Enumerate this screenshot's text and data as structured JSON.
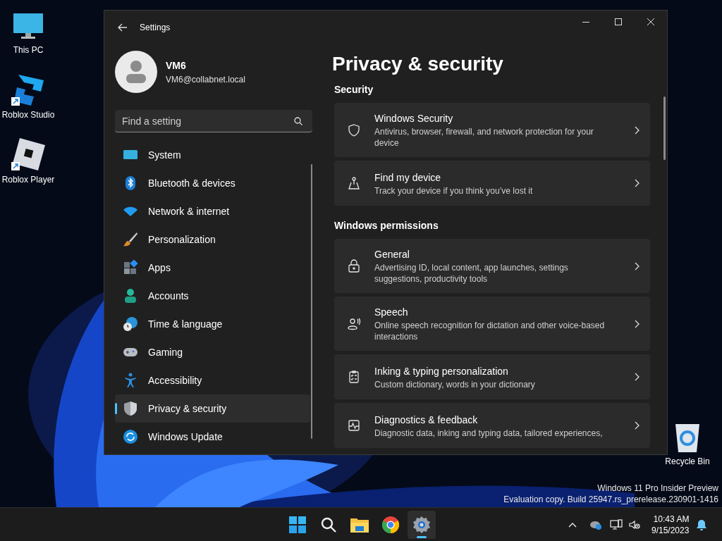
{
  "desktop_icons": [
    {
      "label": "This PC",
      "kind": "monitor",
      "shortcut": false
    },
    {
      "label": "Roblox Studio",
      "kind": "studio",
      "shortcut": true
    },
    {
      "label": "Roblox Player",
      "kind": "player",
      "shortcut": true
    },
    {
      "label": "Recycle Bin",
      "kind": "bin",
      "shortcut": false
    }
  ],
  "window": {
    "title": "Settings",
    "user": {
      "name": "VM6",
      "email": "VM6@collabnet.local"
    },
    "search": {
      "placeholder": "Find a setting"
    },
    "nav": [
      {
        "label": "System",
        "kind": "system",
        "selected": false
      },
      {
        "label": "Bluetooth & devices",
        "kind": "bluetooth",
        "selected": false
      },
      {
        "label": "Network & internet",
        "kind": "wifi",
        "selected": false
      },
      {
        "label": "Personalization",
        "kind": "brush",
        "selected": false
      },
      {
        "label": "Apps",
        "kind": "apps",
        "selected": false
      },
      {
        "label": "Accounts",
        "kind": "person",
        "selected": false
      },
      {
        "label": "Time & language",
        "kind": "globe",
        "selected": false
      },
      {
        "label": "Gaming",
        "kind": "gamepad",
        "selected": false
      },
      {
        "label": "Accessibility",
        "kind": "accessibility",
        "selected": false
      },
      {
        "label": "Privacy & security",
        "kind": "shield",
        "selected": true
      },
      {
        "label": "Windows Update",
        "kind": "update",
        "selected": false
      }
    ],
    "page_title": "Privacy & security",
    "sections": [
      {
        "heading": "Security",
        "items": [
          {
            "title": "Windows Security",
            "description": "Antivirus, browser, firewall, and network protection for your device",
            "kind": "shield"
          },
          {
            "title": "Find my device",
            "description": "Track your device if you think you’ve lost it",
            "kind": "locate"
          }
        ]
      },
      {
        "heading": "Windows permissions",
        "items": [
          {
            "title": "General",
            "description": "Advertising ID, local content, app launches, settings suggestions, productivity tools",
            "kind": "lock"
          },
          {
            "title": "Speech",
            "description": "Online speech recognition for dictation and other voice-based interactions",
            "kind": "speech"
          },
          {
            "title": "Inking & typing personalization",
            "description": "Custom dictionary, words in your dictionary",
            "kind": "clipboard"
          },
          {
            "title": "Diagnostics & feedback",
            "description": "Diagnostic data, inking and typing data, tailored experiences,",
            "kind": "pulse"
          }
        ]
      }
    ]
  },
  "watermark": [
    "Windows 11 Pro Insider Preview",
    "Evaluation copy. Build 25947.rs_prerelease.230901-1416"
  ],
  "taskbar": {
    "apps": [
      {
        "kind": "start",
        "active": false
      },
      {
        "kind": "search",
        "active": false
      },
      {
        "kind": "folder",
        "active": false
      },
      {
        "kind": "chrome",
        "active": false
      },
      {
        "kind": "settings",
        "active": true
      }
    ],
    "clock": {
      "time": "10:43 AM",
      "date": "9/15/2023"
    }
  }
}
